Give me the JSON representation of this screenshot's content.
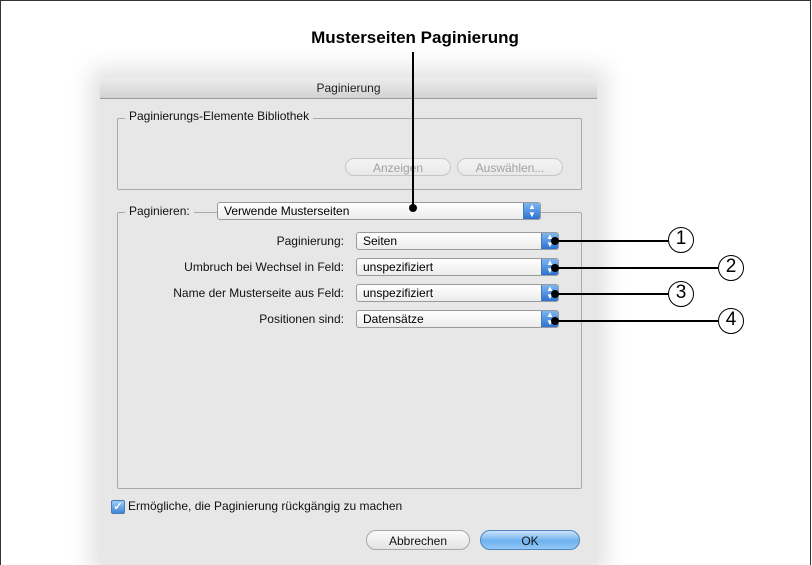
{
  "callout_title": "Musterseiten Paginierung",
  "dialog": {
    "title": "Paginierung",
    "library": {
      "legend": "Paginierungs-Elemente Bibliothek",
      "show_button": "Anzeigen",
      "choose_button": "Auswählen..."
    },
    "paginate": {
      "label": "Paginieren:",
      "value": "Verwende Musterseiten",
      "rows": [
        {
          "label": "Paginierung:",
          "value": "Seiten",
          "callout": "1"
        },
        {
          "label": "Umbruch bei Wechsel in Feld:",
          "value": "unspezifiziert",
          "callout": "2"
        },
        {
          "label": "Name der Musterseite aus Feld:",
          "value": "unspezifiziert",
          "callout": "3"
        },
        {
          "label": "Positionen sind:",
          "value": "Datensätze",
          "callout": "4"
        }
      ]
    },
    "undo_checkbox": {
      "label": "Ermögliche, die Paginierung rückgängig zu machen",
      "checked": true
    },
    "cancel_button": "Abbrechen",
    "ok_button": "OK"
  },
  "colors": {
    "default_button": "#6fb1ef",
    "popup_arrow": "#2d72d2"
  }
}
